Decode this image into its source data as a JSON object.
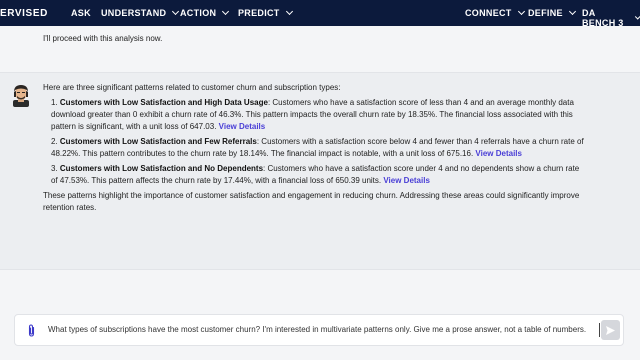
{
  "topbar": {
    "brand": "ERVISED",
    "nav_left": [
      {
        "label": "ASK",
        "has_dropdown": false
      },
      {
        "label": "UNDERSTAND",
        "has_dropdown": true
      },
      {
        "label": "ACTION",
        "has_dropdown": true
      },
      {
        "label": "PREDICT",
        "has_dropdown": true
      }
    ],
    "nav_right": [
      {
        "label": "CONNECT",
        "has_dropdown": true
      },
      {
        "label": "DEFINE",
        "has_dropdown": true
      },
      {
        "label": "DA BENCH 3",
        "has_dropdown": true
      }
    ]
  },
  "chat": {
    "prev_message": "I'll proceed with this analysis now.",
    "answer": {
      "intro": "Here are three significant patterns related to customer churn and subscription types:",
      "items": [
        {
          "number": "1.",
          "title": "Customers with Low Satisfaction and High Data Usage",
          "text": ": Customers who have a satisfaction score of less than 4 and an average monthly data download greater than 0 exhibit a churn rate of 46.3%. This pattern impacts the overall churn rate by 18.35%. The financial loss associated with this pattern is significant, with a unit loss of 647.03.",
          "link": "View Details"
        },
        {
          "number": "2.",
          "title": "Customers with Low Satisfaction and Few Referrals",
          "text": ": Customers with a satisfaction score below 4 and fewer than 4 referrals have a churn rate of 48.22%. This pattern contributes to the churn rate by 18.14%. The financial impact is notable, with a unit loss of 675.16.",
          "link": "View Details"
        },
        {
          "number": "3.",
          "title": "Customers with Low Satisfaction and No Dependents",
          "text": ": Customers who have a satisfaction score under 4 and no dependents show a churn rate of 47.53%. This pattern affects the churn rate by 17.44%, with a financial loss of 650.39 units.",
          "link": "View Details"
        }
      ],
      "conclusion": "These patterns highlight the importance of customer satisfaction and engagement in reducing churn. Addressing these areas could significantly improve retention rates."
    }
  },
  "input": {
    "value": "What types of subscriptions have the most customer churn? I'm interested in multivariate patterns only. Give me a prose answer, not a table of numbers."
  },
  "icons": {
    "attach": "paperclip-icon",
    "send": "send-icon",
    "avatar": "assistant-avatar"
  },
  "colors": {
    "topbar_bg": "#0c1a3c",
    "link": "#4a3fd6",
    "answer_bg": "#eceef1"
  }
}
